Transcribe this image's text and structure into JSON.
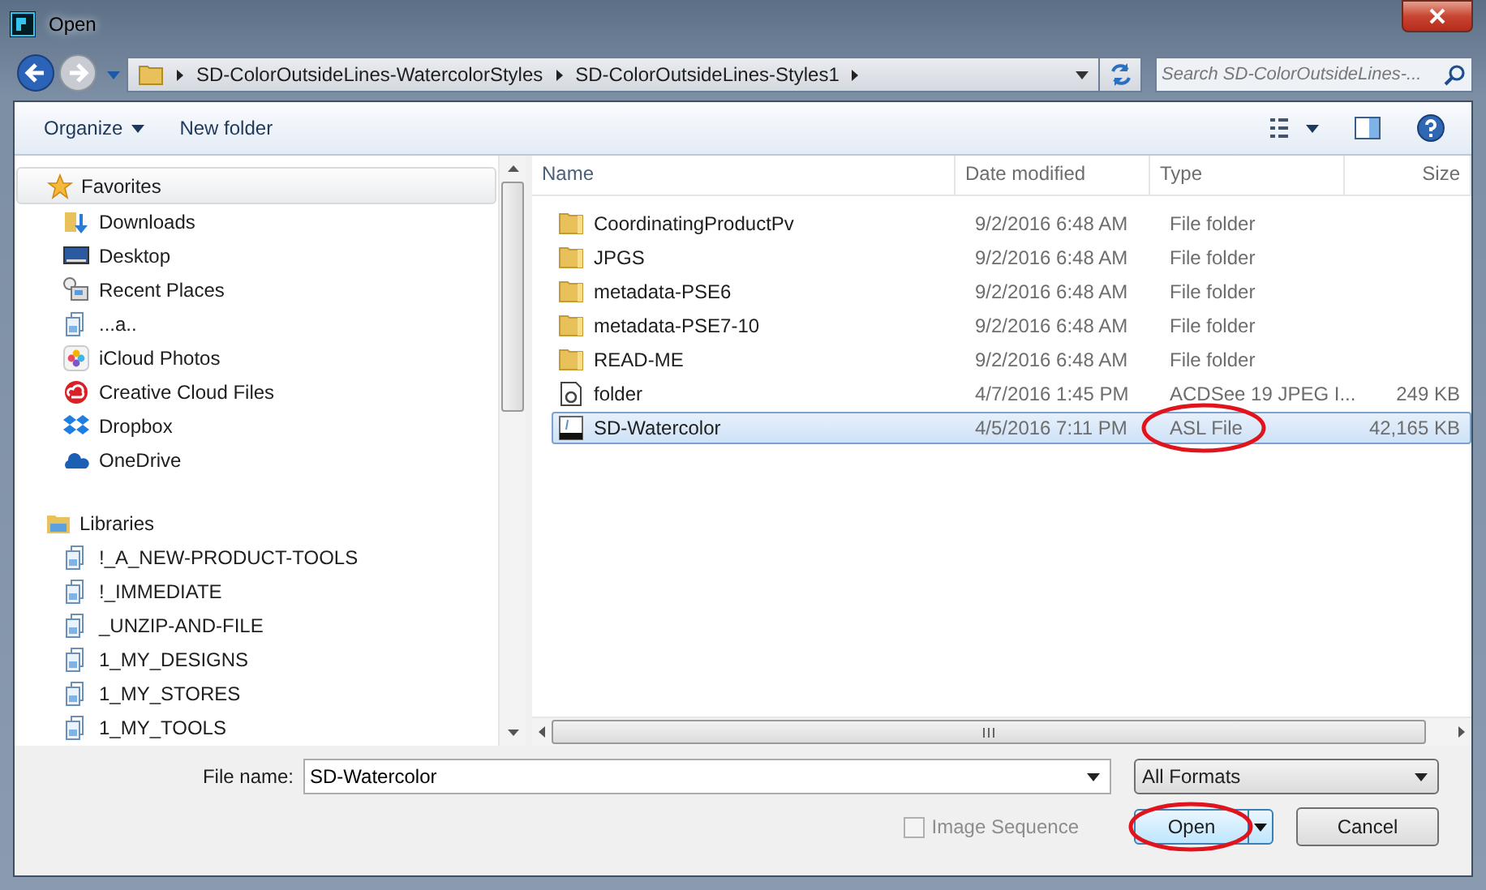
{
  "window": {
    "title": "Open"
  },
  "address": {
    "crumbs": [
      "SD-ColorOutsideLines-WatercolorStyles",
      "SD-ColorOutsideLines-Styles1"
    ]
  },
  "search": {
    "placeholder": "Search SD-ColorOutsideLines-..."
  },
  "toolbar": {
    "organize": "Organize",
    "new_folder": "New folder"
  },
  "sidebar": {
    "groups": [
      {
        "label": "Favorites",
        "kind": "favorites",
        "items": [
          {
            "label": "Downloads",
            "kind": "downloads"
          },
          {
            "label": "Desktop",
            "kind": "desktop"
          },
          {
            "label": "Recent Places",
            "kind": "recent"
          },
          {
            "label": "...a..",
            "kind": "library"
          },
          {
            "label": "iCloud Photos",
            "kind": "photos"
          },
          {
            "label": "Creative Cloud Files",
            "kind": "creative"
          },
          {
            "label": "Dropbox",
            "kind": "dropbox"
          },
          {
            "label": "OneDrive",
            "kind": "onedrive"
          }
        ]
      },
      {
        "label": "Libraries",
        "kind": "libraries",
        "items": [
          {
            "label": "!_A_NEW-PRODUCT-TOOLS",
            "kind": "library"
          },
          {
            "label": "!_IMMEDIATE",
            "kind": "library"
          },
          {
            "label": "_UNZIP-AND-FILE",
            "kind": "library"
          },
          {
            "label": "1_MY_DESIGNS",
            "kind": "library"
          },
          {
            "label": "1_MY_STORES",
            "kind": "library"
          },
          {
            "label": "1_MY_TOOLS",
            "kind": "library"
          }
        ]
      }
    ]
  },
  "table": {
    "columns": [
      "Name",
      "Date modified",
      "Type",
      "Size"
    ],
    "rows": [
      {
        "name": "CoordinatingProductPv",
        "date": "9/2/2016 6:48 AM",
        "type": "File folder",
        "kind": "folder",
        "selected": false,
        "circled": false
      },
      {
        "name": "JPGS",
        "date": "9/2/2016 6:48 AM",
        "type": "File folder",
        "kind": "folder",
        "selected": false,
        "circled": false
      },
      {
        "name": "metadata-PSE6",
        "date": "9/2/2016 6:48 AM",
        "type": "File folder",
        "kind": "folder",
        "selected": false,
        "circled": false
      },
      {
        "name": "metadata-PSE7-10",
        "date": "9/2/2016 6:48 AM",
        "type": "File folder",
        "kind": "folder",
        "selected": false,
        "circled": false
      },
      {
        "name": "READ-ME",
        "date": "9/2/2016 6:48 AM",
        "type": "File folder",
        "kind": "folder",
        "selected": false,
        "circled": false
      },
      {
        "name": "folder",
        "date": "4/7/2016 1:45 PM",
        "type": "ACDSee 19 JPEG I...",
        "size": "249 KB",
        "kind": "jpeg",
        "selected": false,
        "circled": false
      },
      {
        "name": "SD-Watercolor",
        "date": "4/5/2016 7:11 PM",
        "type": "ASL File",
        "size": "42,165 KB",
        "kind": "asl",
        "selected": true,
        "circled": true
      }
    ]
  },
  "file_name": {
    "label": "File name:",
    "value": "SD-Watercolor"
  },
  "filter": {
    "value": "All Formats"
  },
  "image_sequence": {
    "label": "Image Sequence",
    "checked": false,
    "disabled": true
  },
  "buttons": [
    {
      "label": "Open",
      "kind": "split",
      "circled": true
    },
    {
      "label": "Cancel",
      "kind": "plain",
      "circled": false
    }
  ]
}
